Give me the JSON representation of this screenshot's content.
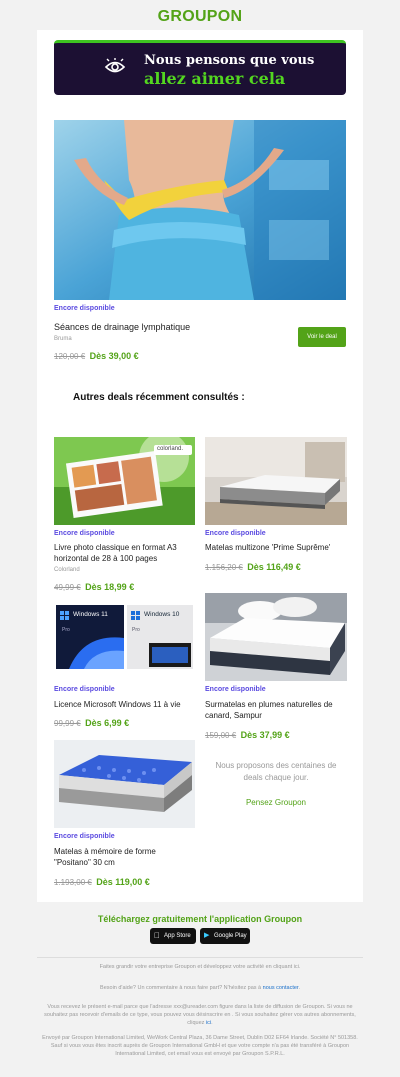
{
  "header": {
    "logo": "GROUPON"
  },
  "banner": {
    "line1": "Nous pensons que vous",
    "line2": "allez aimer cela"
  },
  "featured": {
    "status": "Encore disponible",
    "title": "Séances de drainage lymphatique",
    "merchant": "Bruma",
    "old_price": "120,00 €",
    "new_price": "Dès 39,00 €",
    "button": "Voir le deal"
  },
  "recent": {
    "title": "Autres deals récemment consultés :",
    "items": [
      {
        "status": "Encore disponible",
        "title": "Livre photo classique en format A3 horizontal de 28 à 100 pages",
        "merchant": "Colorland",
        "old_price": "49,99 €",
        "new_price": "Dès 18,99 €",
        "brand_badge": "colorland."
      },
      {
        "status": "Encore disponible",
        "title": "Matelas multizone 'Prime Suprême'",
        "merchant": "",
        "old_price": "1.156,20 €",
        "new_price": "Dès 116,49 €"
      },
      {
        "status": "Encore disponible",
        "title": "Licence Microsoft Windows 11 à vie",
        "merchant": "",
        "old_price": "99,99 €",
        "new_price": "Dès 6,99 €",
        "win_a": "Windows 11",
        "win_b": "Windows 10",
        "pro": "Pro"
      },
      {
        "status": "Encore disponible",
        "title": "Surmatelas en plumes naturelles de canard, Sampur",
        "merchant": "",
        "old_price": "159,00 €",
        "new_price": "Dès 37,99 €"
      },
      {
        "status": "Encore disponible",
        "title": "Matelas à mémoire de forme \"Positano\" 30 cm",
        "merchant": "",
        "old_price": "1.193,00 €",
        "new_price": "Dès 119,00 €"
      }
    ],
    "empty_text": "Nous proposons des centaines de deals chaque jour.",
    "empty_link": "Pensez Groupon"
  },
  "app": {
    "title": "Téléchargez gratuitement l'application Groupon",
    "appstore": "App Store",
    "googleplay": "Google Play"
  },
  "footer": {
    "grow": "Faites grandir votre entreprise Groupon et développez votre activité en cliquant ici.",
    "help_prefix": "Besoin d'aide? Un commentaire à nous faire part? N'hésitez pas à",
    "help_link": "nous contacter",
    "legal1": "Vous recevez le présent e-mail parce que l'adresse xxx@ureader.com figure dans la liste de diffusion de Groupon. Si vous ne souhaitez pas recevoir d'emails de ce type, vous pouvez vous désinscrire en . Si vous souhaitez gérer vos autres abonnements, cliquez",
    "legal1_link": "ici",
    "legal2": "Envoyé par Groupon International Limited, WeWork Central Plaza, 36 Dame Street, Dublin D02 EF64 Irlande. Société N° 501358. Sauf si vous vous êtes inscrit auprès de Groupon International GmbH et que votre compte n'a pas été transféré à Groupon International Limited, cet email vous est envoyé par Groupon S.P.R.L."
  },
  "colors": {
    "brand_green": "#53a318",
    "banner_bg": "#1c1033",
    "available_purple": "#5b4be0"
  }
}
